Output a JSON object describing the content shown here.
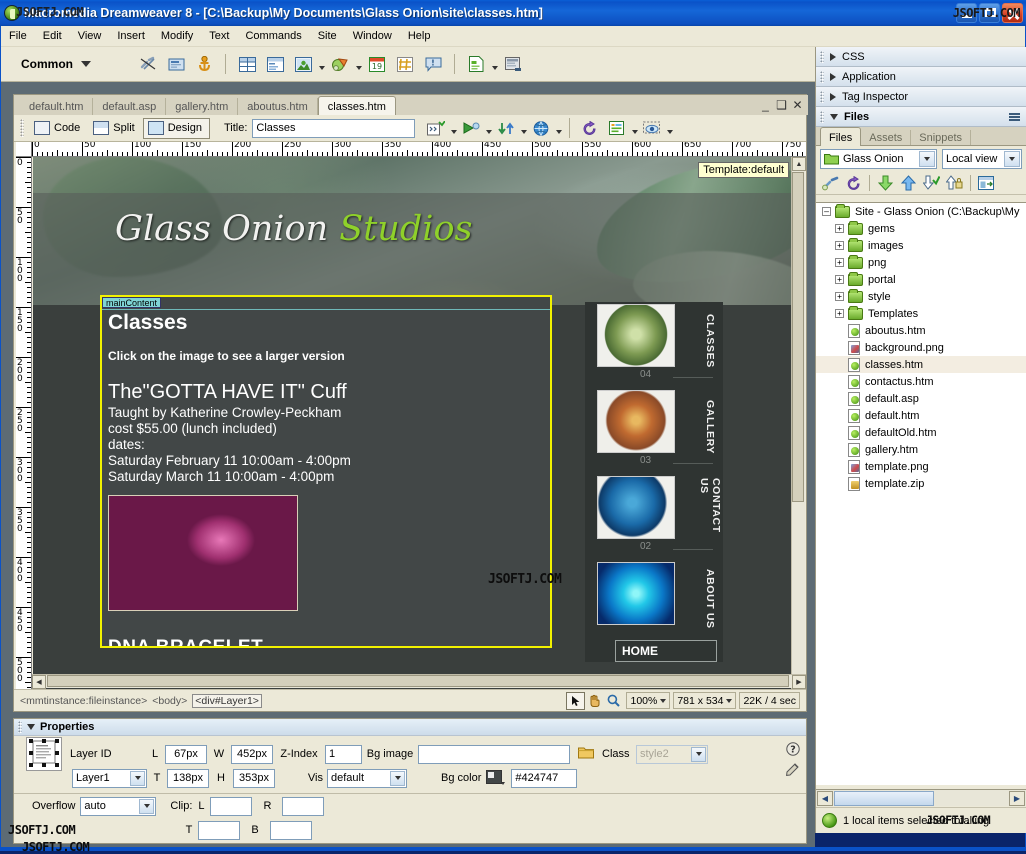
{
  "titlebar": {
    "title": "Macromedia Dreamweaver 8 - [C:\\Backup\\My Documents\\Glass Onion\\site\\classes.htm]",
    "watermark": "JSOFTJ.COM",
    "app_icon": "dreamweaver-icon",
    "buttons": {
      "minimize": "minimize-icon",
      "maximize": "maximize-icon",
      "close": "close-icon"
    }
  },
  "menubar": {
    "items": [
      "File",
      "Edit",
      "View",
      "Insert",
      "Modify",
      "Text",
      "Commands",
      "Site",
      "Window",
      "Help"
    ]
  },
  "insertbar": {
    "category": "Common",
    "icons": [
      "hyperlink-break-icon",
      "email-link-icon",
      "named-anchor-icon",
      "table-icon",
      "table-objects-icon",
      "images-icon",
      "media-icon",
      "date-icon",
      "server-side-include-icon",
      "comment-icon",
      "template-icon",
      "tag-chooser-icon"
    ]
  },
  "document": {
    "tabs": [
      {
        "label": "default.htm",
        "active": false
      },
      {
        "label": "default.asp",
        "active": false
      },
      {
        "label": "gallery.htm",
        "active": false
      },
      {
        "label": "aboutus.htm",
        "active": false
      },
      {
        "label": "classes.htm",
        "active": true
      }
    ],
    "window_controls": {
      "minimize": "minimize-icon",
      "restore": "restore-icon",
      "close": "close-icon"
    },
    "view_buttons": [
      {
        "label": "Code",
        "active": false
      },
      {
        "label": "Split",
        "active": false
      },
      {
        "label": "Design",
        "active": true
      }
    ],
    "title_field": {
      "label": "Title:",
      "value": "Classes",
      "placeholder": ""
    },
    "toolbar_icons": [
      "file-management-icon",
      "preview-browser-icon",
      "refresh-design-icon",
      "view-options-icon",
      "validate-markup-icon",
      "check-browser-support-icon",
      "visual-aids-icon"
    ],
    "template_badge": "Template:default"
  },
  "rulers": {
    "horizontal_labels": [
      "0",
      "50",
      "100",
      "150",
      "200",
      "250",
      "300",
      "350",
      "400",
      "450",
      "500",
      "550",
      "600",
      "650",
      "700",
      "750"
    ],
    "vertical_labels": [
      "0",
      "50",
      "100",
      "150",
      "200",
      "250",
      "300",
      "350",
      "400",
      "450",
      "500"
    ],
    "unit": "px",
    "interval": 50
  },
  "page": {
    "logo": {
      "white": "Glass  Onion",
      "green": "Studios"
    },
    "layer_label": "mainContent",
    "heading": "Classes",
    "subnote": "Click on the image to see a larger version",
    "class_title": "The\"GOTTA HAVE IT\" Cuff",
    "lines": [
      "Taught by Katherine Crowley-Peckham",
      "cost $55.00 (lunch included)",
      "dates:",
      "Saturday February 11 10:00am - 4:00pm",
      "Saturday March 11 10:00am - 4:00pm"
    ],
    "image_alt": "bracelet-photo",
    "image_caption": "DNA BRACELET",
    "watermark": "JSOFTJ.COM",
    "nav": [
      {
        "label": "CLASSES",
        "number": "04",
        "thumb": "green-glass-bead-thumb"
      },
      {
        "label": "GALLERY",
        "number": "03",
        "thumb": "orange-glass-bead-thumb"
      },
      {
        "label": "CONTACT US",
        "number": "02",
        "thumb": "blue-glass-bead-thumb"
      },
      {
        "label": "ABOUT US",
        "number": "",
        "thumb": "cyan-swirl-thumb"
      }
    ],
    "home_button": "HOME"
  },
  "doc_status": {
    "tag_selector": [
      "<mmtinstance:fileinstance>",
      "<body>",
      "<div#Layer1>"
    ],
    "tools": [
      "select-tool-icon",
      "hand-tool-icon",
      "zoom-tool-icon"
    ],
    "zoom": "100%",
    "window_size": "781 x 534",
    "download_size": "22K / 4 sec"
  },
  "properties": {
    "title": "Properties",
    "icon": "layer-properties-icon",
    "layer_id_label": "Layer ID",
    "layer_id_value": "Layer1",
    "L_label": "L",
    "L_value": "67px",
    "W_label": "W",
    "W_value": "452px",
    "zindex_label": "Z-Index",
    "zindex_value": "1",
    "bgimage_label": "Bg image",
    "bgimage_value": "",
    "folder_icon": "browse-folder-icon",
    "class_label": "Class",
    "class_value": "style2",
    "T_label": "T",
    "T_value": "138px",
    "H_label": "H",
    "H_value": "353px",
    "vis_label": "Vis",
    "vis_value": "default",
    "bgcolor_label": "Bg color",
    "bgcolor_value": "#424747",
    "overflow_label": "Overflow",
    "overflow_value": "auto",
    "clip_label": "Clip:",
    "clip_L_label": "L",
    "clip_L_value": "",
    "clip_R_label": "R",
    "clip_R_value": "",
    "clip_T_label": "T",
    "clip_T_value": "",
    "clip_B_label": "B",
    "clip_B_value": "",
    "help_icon": "help-icon",
    "quickedit_icon": "quick-tag-editor-icon",
    "watermark": "JSOFTJ.COM"
  },
  "dock": {
    "collapsed_panels": [
      {
        "label": "CSS"
      },
      {
        "label": "Application"
      },
      {
        "label": "Tag Inspector"
      }
    ],
    "files_panel": {
      "title": "Files",
      "options_icon": "panel-options-icon",
      "tabs": [
        {
          "label": "Files",
          "active": true
        },
        {
          "label": "Assets",
          "active": false
        },
        {
          "label": "Snippets",
          "active": false
        }
      ],
      "site_select": "Glass Onion",
      "view_select": "Local view",
      "tools": [
        "connect-remote-icon",
        "refresh-icon",
        "get-files-icon",
        "put-files-icon",
        "check-out-icon",
        "check-in-icon",
        "expand-collapse-icon"
      ],
      "tree": [
        {
          "label": "Site - Glass Onion (C:\\Backup\\My",
          "type": "folder",
          "depth": 0,
          "expander": "minus",
          "selected": false
        },
        {
          "label": "gems",
          "type": "folder",
          "depth": 1,
          "expander": "plus",
          "selected": false
        },
        {
          "label": "images",
          "type": "folder",
          "depth": 1,
          "expander": "plus",
          "selected": false
        },
        {
          "label": "png",
          "type": "folder",
          "depth": 1,
          "expander": "plus",
          "selected": false
        },
        {
          "label": "portal",
          "type": "folder",
          "depth": 1,
          "expander": "plus",
          "selected": false
        },
        {
          "label": "style",
          "type": "folder",
          "depth": 1,
          "expander": "plus",
          "selected": false
        },
        {
          "label": "Templates",
          "type": "folder",
          "depth": 1,
          "expander": "plus",
          "selected": false
        },
        {
          "label": "aboutus.htm",
          "type": "htm",
          "depth": 1,
          "expander": "none",
          "selected": false
        },
        {
          "label": "background.png",
          "type": "png",
          "depth": 1,
          "expander": "none",
          "selected": false
        },
        {
          "label": "classes.htm",
          "type": "htm",
          "depth": 1,
          "expander": "none",
          "selected": true
        },
        {
          "label": "contactus.htm",
          "type": "htm",
          "depth": 1,
          "expander": "none",
          "selected": false
        },
        {
          "label": "default.asp",
          "type": "htm",
          "depth": 1,
          "expander": "none",
          "selected": false
        },
        {
          "label": "default.htm",
          "type": "htm",
          "depth": 1,
          "expander": "none",
          "selected": false
        },
        {
          "label": "defaultOld.htm",
          "type": "htm",
          "depth": 1,
          "expander": "none",
          "selected": false
        },
        {
          "label": "gallery.htm",
          "type": "htm",
          "depth": 1,
          "expander": "none",
          "selected": false
        },
        {
          "label": "template.png",
          "type": "png",
          "depth": 1,
          "expander": "none",
          "selected": false
        },
        {
          "label": "template.zip",
          "type": "zip",
          "depth": 1,
          "expander": "none",
          "selected": false
        }
      ],
      "status_text": "1 local items selected totalling",
      "status_watermark": "JSOFTJ.COM"
    }
  },
  "bottom_watermark": "JSOFTJ.COM",
  "colors": {
    "titlebar_blue": "#0a52c8",
    "chrome": "#ece9d8",
    "layer_border": "#f2f200",
    "layer_bg": "#424747",
    "page_dark": "#3a3f3d",
    "logo_green": "#8fd12a"
  }
}
